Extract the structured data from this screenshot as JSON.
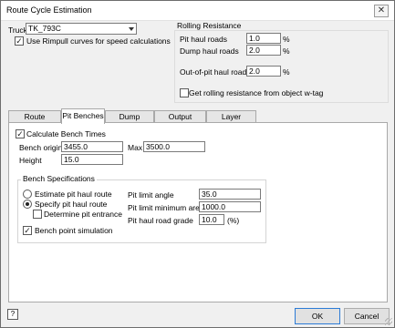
{
  "window": {
    "title": "Route Cycle Estimation",
    "close_glyph": "✕"
  },
  "truck": {
    "label": "Truck",
    "selected": "TK_793C",
    "rimpull_checked": true,
    "rimpull_label": "Use Rimpull curves for speed calculations"
  },
  "rolling_resistance": {
    "title": "Rolling Resistance",
    "pit_haul_label": "Pit haul roads",
    "pit_haul_value": "1.0",
    "dump_haul_label": "Dump haul roads",
    "dump_haul_value": "2.0",
    "out_of_pit_label": "Out-of-pit haul roads",
    "out_of_pit_value": "2.0",
    "unit": "%",
    "from_wtag_checked": false,
    "from_wtag_label": "Get rolling resistance from object w-tag"
  },
  "tabs": [
    {
      "label": "Route Selection",
      "active": false
    },
    {
      "label": "Pit Benches",
      "active": true
    },
    {
      "label": "Dump Benches",
      "active": false
    },
    {
      "label": "Output Settings",
      "active": false
    },
    {
      "label": "Layer Creation",
      "active": false
    }
  ],
  "pit_benches": {
    "calculate_checked": true,
    "calculate_label": "Calculate Bench Times",
    "bench_origin_label": "Bench origin",
    "bench_origin_value": "3455.0",
    "max_label": "Max",
    "max_value": "3500.0",
    "height_label": "Height",
    "height_value": "15.0",
    "spec": {
      "title": "Bench Specifications",
      "estimate_label": "Estimate pit haul route",
      "estimate_selected": false,
      "specify_label": "Specify pit haul route",
      "specify_selected": true,
      "determine_label": "Determine pit entrance",
      "determine_checked": false,
      "pit_limit_angle_label": "Pit limit angle",
      "pit_limit_angle_value": "35.0",
      "pit_limit_min_area_label": "Pit limit minimum area",
      "pit_limit_min_area_value": "1000.0",
      "pit_haul_grade_label": "Pit haul road grade",
      "pit_haul_grade_value": "10.0",
      "pit_haul_grade_unit": "(%)",
      "bench_point_sim_checked": true,
      "bench_point_sim_label": "Bench point simulation"
    }
  },
  "footer": {
    "ok_label": "OK",
    "cancel_label": "Cancel",
    "help_glyph": "?"
  }
}
